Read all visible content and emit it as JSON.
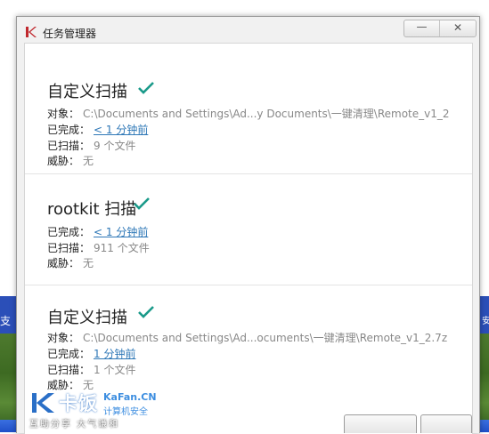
{
  "window": {
    "title": "任务管理器",
    "minimize_symbol": "—",
    "close_symbol": "✕"
  },
  "tasks": [
    {
      "title": "自定义扫描",
      "rows": [
        {
          "label": "对象：",
          "value": "C:\\Documents and Settings\\Ad...y Documents\\一键清理\\Remote_v1_2",
          "link": false
        },
        {
          "label": "已完成：",
          "value": "< 1 分钟前",
          "link": true
        },
        {
          "label": "已扫描：",
          "value": "9 个文件",
          "link": false
        },
        {
          "label": "威胁：",
          "value": "无",
          "link": false
        }
      ]
    },
    {
      "title": "rootkit 扫描",
      "rows": [
        {
          "label": "已完成：",
          "value": "< 1 分钟前",
          "link": true
        },
        {
          "label": "已扫描：",
          "value": "911 个文件",
          "link": false
        },
        {
          "label": "威胁：",
          "value": "无",
          "link": false
        }
      ]
    },
    {
      "title": "自定义扫描",
      "rows": [
        {
          "label": "对象：",
          "value": "C:\\Documents and Settings\\Ad...ocuments\\一键清理\\Remote_v1_2.7z",
          "link": false
        },
        {
          "label": "已完成：",
          "value": "1 分钟前",
          "link": true
        },
        {
          "label": "已扫描：",
          "value": "1 个文件",
          "link": false
        },
        {
          "label": "威胁：",
          "value": "无",
          "link": false
        }
      ]
    }
  ],
  "background": {
    "left_text": "支",
    "right_text": "安"
  },
  "watermark": {
    "cn": "卡饭",
    "en": "KaFan.CN",
    "sub": "计算机安全",
    "slogan": "互助分享  大气谦和"
  },
  "colors": {
    "check": "#1a9a8a",
    "link": "#2f78b7",
    "desktop_band": "#2b4fb8"
  }
}
